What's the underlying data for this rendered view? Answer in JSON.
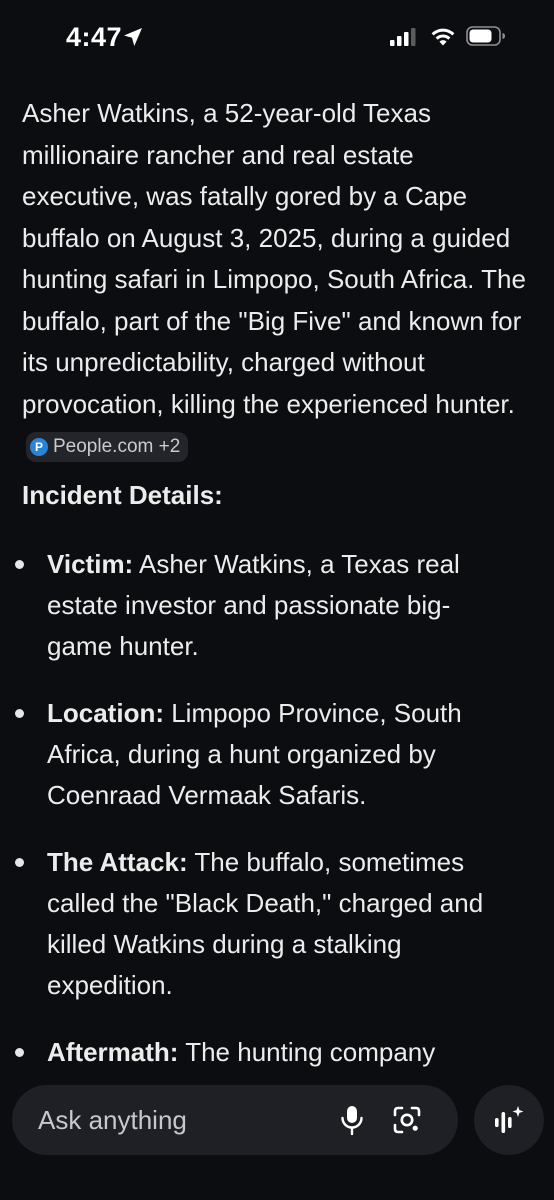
{
  "status_bar": {
    "time": "4:47"
  },
  "content": {
    "intro_text": "Asher Watkins, a 52-year-old Texas millionaire rancher and real estate executive, was fatally gored by a Cape buffalo on August 3, 2025, during a guided hunting safari in Limpopo, South Africa. The buffalo, part of the \"Big Five\" and known for its unpredictability, charged without provocation, killing the experienced hunter.",
    "source_chip": {
      "logo_letter": "P",
      "label": "People.com +2"
    },
    "section_heading": "Incident Details:",
    "details": [
      {
        "term": "Victim:",
        "text": " Asher Watkins, a Texas real estate investor and passionate big-game hunter."
      },
      {
        "term": "Location:",
        "text": " Limpopo Province, South Africa, during a hunt organized by Coenraad Vermaak Safaris."
      },
      {
        "term": "The Attack:",
        "text": " The buffalo, sometimes called the \"Black Death,\" charged and killed Watkins during a stalking expedition."
      },
      {
        "term": "Aftermath:",
        "text": " The hunting company described the incident as sudden and"
      }
    ]
  },
  "input_bar": {
    "placeholder": "Ask anything"
  },
  "icons": {
    "location": "location-arrow-icon",
    "signal": "cellular-signal-icon",
    "wifi": "wifi-icon",
    "battery": "battery-icon",
    "mic": "microphone-icon",
    "lens": "camera-lens-icon",
    "live": "voice-sparkle-icon"
  }
}
